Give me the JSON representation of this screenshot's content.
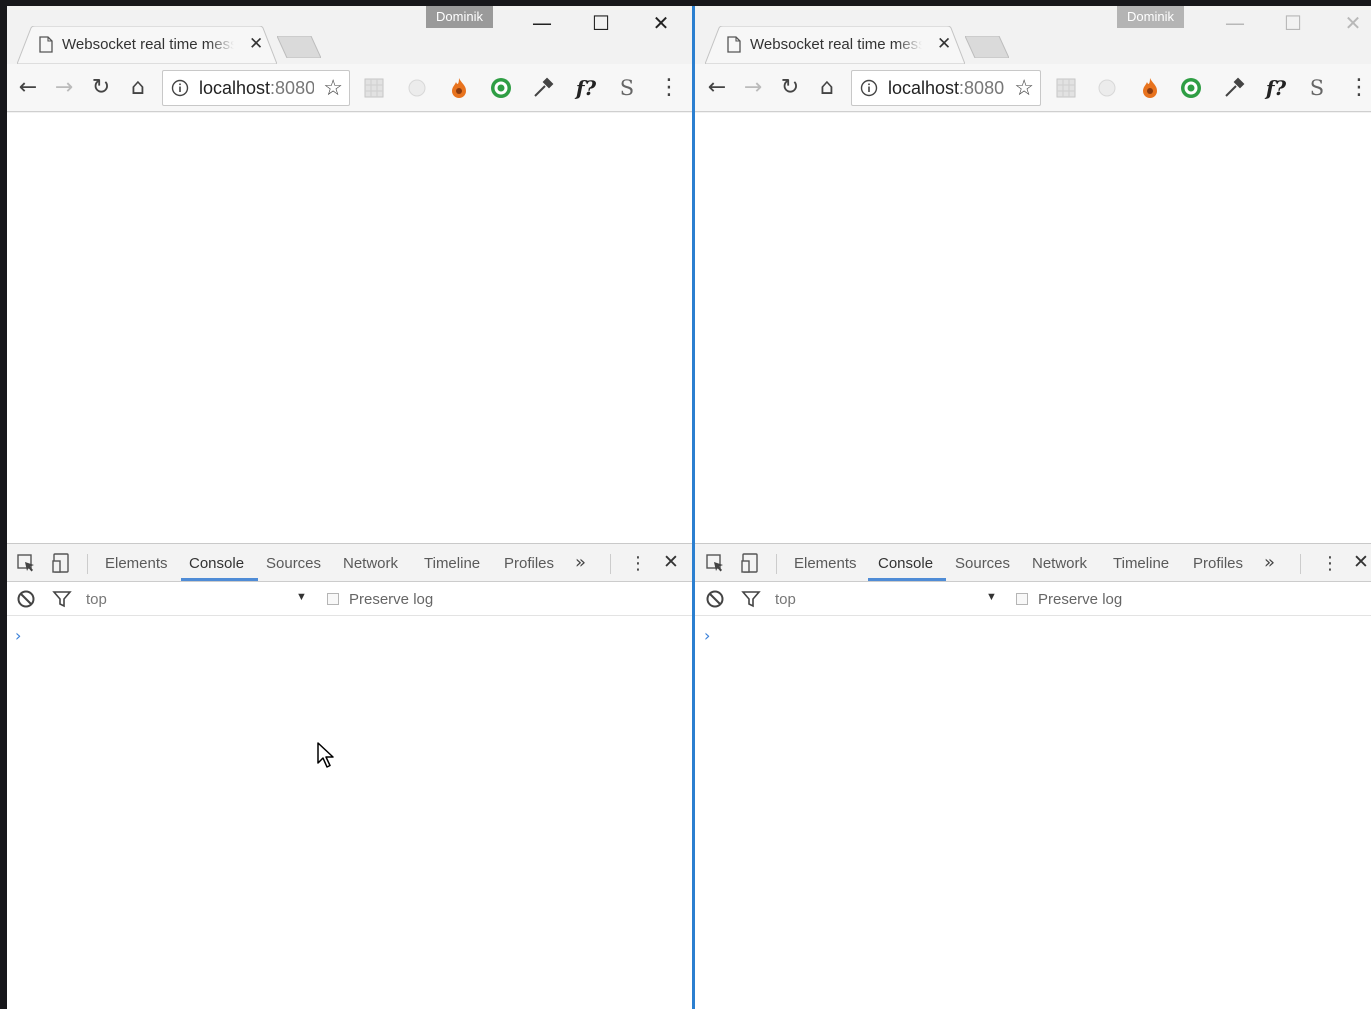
{
  "windows": [
    {
      "profile": "Dominik",
      "window_controls": {
        "minimize": "—",
        "maximize": "☐",
        "close": "✕"
      },
      "tab": {
        "title": "Websocket real time messages",
        "close": "✕"
      },
      "address": {
        "host": "localhost",
        "port": ":8080"
      },
      "devtools": {
        "tabs": [
          "Elements",
          "Console",
          "Sources",
          "Network",
          "Timeline",
          "Profiles"
        ],
        "active_tab": "Console",
        "more": "»",
        "context": "top",
        "preserve_log": "Preserve log",
        "prompt": "›"
      }
    },
    {
      "profile": "Dominik",
      "window_controls": {
        "minimize": "—",
        "maximize": "☐",
        "close": "✕"
      },
      "tab": {
        "title": "Websocket real time messages",
        "close": "✕"
      },
      "address": {
        "host": "localhost",
        "port": ":8080"
      },
      "devtools": {
        "tabs": [
          "Elements",
          "Console",
          "Sources",
          "Network",
          "Timeline",
          "Profiles"
        ],
        "active_tab": "Console",
        "more": "»",
        "context": "top",
        "preserve_log": "Preserve log",
        "prompt": "›"
      }
    }
  ],
  "toolbar_glyphs": {
    "back": "←",
    "forward": "→",
    "reload": "↻",
    "home": "⌂",
    "star": "☆",
    "menu": "⋮",
    "fn": "f?",
    "s": "S"
  },
  "icons": [
    "back-icon",
    "forward-icon",
    "reload-icon",
    "home-icon",
    "info-icon",
    "star-icon",
    "extension-icon",
    "inspect-icon",
    "device-icon",
    "clear-icon",
    "filter-icon",
    "kebab-icon",
    "close-icon",
    "mouse-cursor-icon"
  ],
  "colors": {
    "accent": "#4f8cd6",
    "window_edge": "#2b7fd0",
    "chrome_bg": "#f2f2f2",
    "extension_orange": "#e8731e",
    "extension_green": "#2f9e44"
  }
}
